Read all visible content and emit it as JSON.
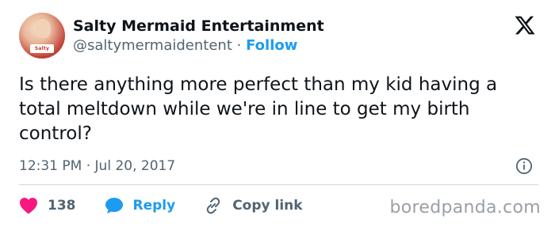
{
  "author": {
    "display_name": "Salty Mermaid Entertainment",
    "handle": "@saltymermaidentent",
    "separator": "·",
    "follow_label": "Follow",
    "avatar_badge_text": "Salty Mermaid"
  },
  "tweet": {
    "text": "Is there anything more perfect than my kid having a total meltdown while we're in line to get my birth control?",
    "timestamp": "12:31 PM · Jul 20, 2017"
  },
  "actions": {
    "likes_count": "138",
    "reply_label": "Reply",
    "copy_link_label": "Copy link"
  },
  "icons": {
    "brand": "x-logo-icon",
    "info": "info-icon",
    "like": "heart-icon",
    "reply": "reply-bubble-icon",
    "copy": "link-icon"
  },
  "colors": {
    "accent": "#1d9bf0",
    "like": "#f91880",
    "text": "#0f1419",
    "muted": "#536471"
  },
  "watermark": "boredpanda.com"
}
